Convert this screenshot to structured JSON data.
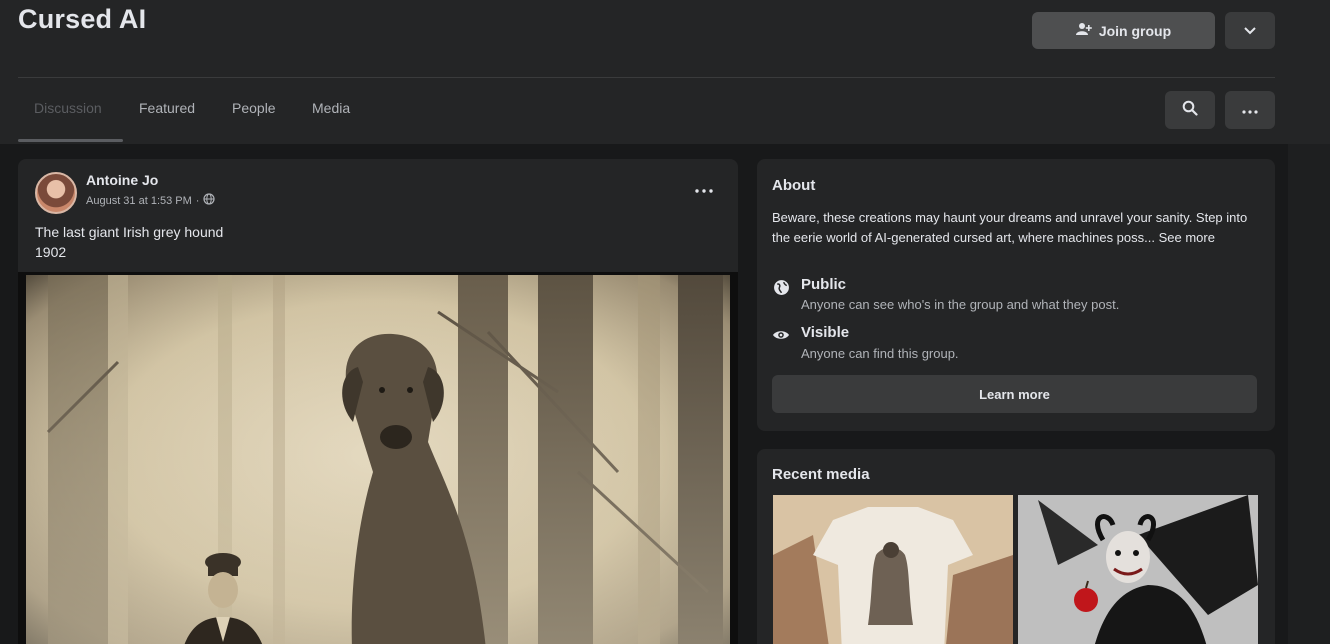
{
  "header": {
    "title": "Cursed AI",
    "join_label": "Join group",
    "join_icon": "join-group-icon",
    "menu_icon": "chevron-down-icon"
  },
  "tabs": [
    {
      "label": "Discussion",
      "active": true
    },
    {
      "label": "Featured",
      "active": false
    },
    {
      "label": "People",
      "active": false
    },
    {
      "label": "Media",
      "active": false
    }
  ],
  "toolbar": {
    "search_icon": "search-icon",
    "more_icon": "more-icon"
  },
  "post": {
    "author": "Antoine Jo",
    "timestamp": "August 31 at 1:53 PM",
    "privacy_icon": "globe-icon",
    "text_line1": "The last giant Irish grey hound",
    "text_line2": "1902",
    "image_alt": "Sepia photograph of a giant grey hound standing next to a man in a forest"
  },
  "about": {
    "title": "About",
    "description": "Beware, these creations may haunt your dreams and unravel your sanity. Step into the eerie world of AI-generated cursed art, where machines poss...",
    "see_more": "See more",
    "public_title": "Public",
    "public_desc": "Anyone can see who's in the group and what they post.",
    "visible_title": "Visible",
    "visible_desc": "Anyone can find this group.",
    "learn_more": "Learn more"
  },
  "recent_media": {
    "title": "Recent media"
  },
  "colors": {
    "page_bg": "#18191a",
    "card_bg": "#242526",
    "button_bg": "#3a3b3c",
    "join_bg": "#4e4f50",
    "text_primary": "#e4e6eb",
    "text_secondary": "#b0b3b8"
  }
}
